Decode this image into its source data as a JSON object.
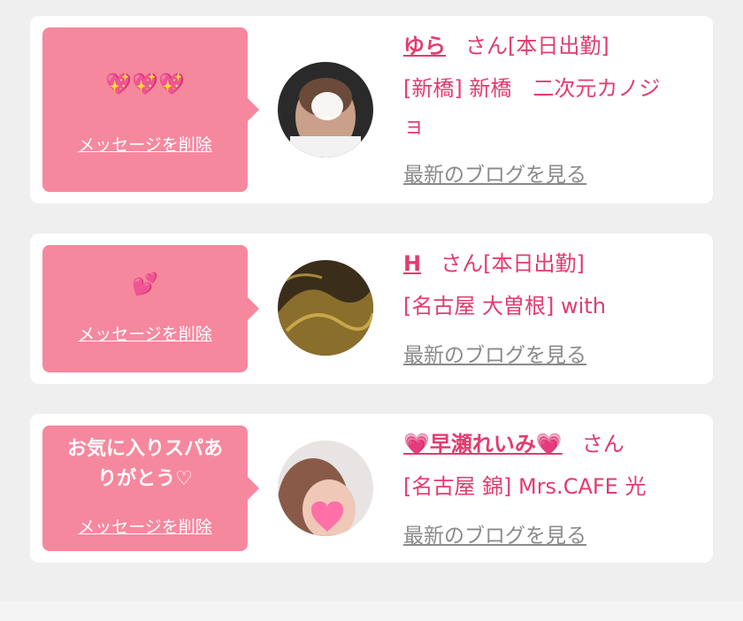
{
  "colors": {
    "accent": "#e23c6e",
    "bubble": "#f6889e",
    "link_gray": "#8a8a8a",
    "background": "#efefef"
  },
  "cards": [
    {
      "message": "💖💖💖",
      "delete_label": "メッセージを削除",
      "avatar_icon": "avatar-photo",
      "name": "ゆら",
      "suffix": "さん[本日出勤]",
      "shop_line1": "[新橋] 新橋　二次元カノジ",
      "shop_line2": "ョ",
      "blog_label": "最新のブログを見る"
    },
    {
      "message": "💕",
      "delete_label": "メッセージを削除",
      "avatar_icon": "avatar-photo",
      "name": "H",
      "suffix": "さん[本日出勤]",
      "shop_line1": "[名古屋 大曽根] with",
      "blog_label": "最新のブログを見る"
    },
    {
      "message_line1": "お気に入りスパあ",
      "message_line2": "りがとう♡",
      "delete_label": "メッセージを削除",
      "avatar_icon": "avatar-photo",
      "name": "💗早瀬れいみ💗",
      "suffix": "さん",
      "shop_line1": "[名古屋 錦] Mrs.CAFE 光",
      "blog_label": "最新のブログを見る"
    }
  ]
}
